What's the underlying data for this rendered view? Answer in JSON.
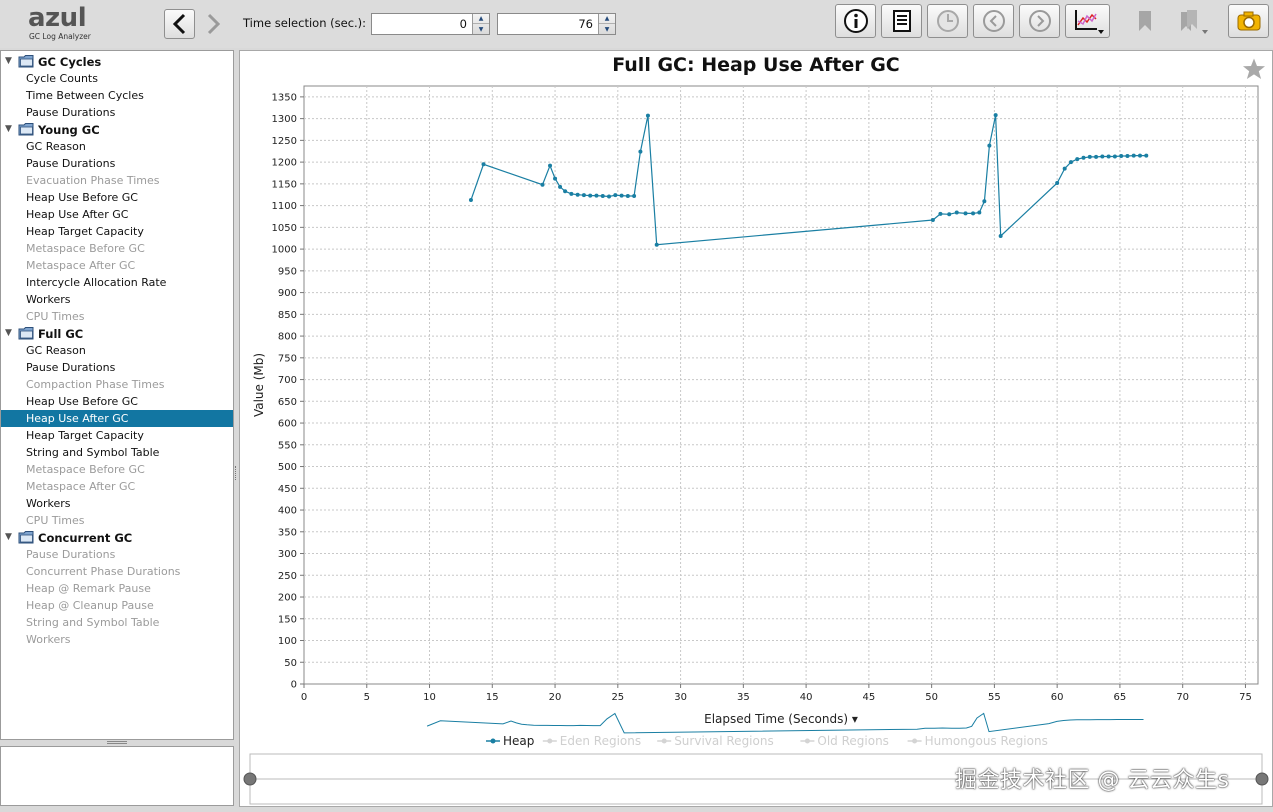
{
  "app": {
    "logo_text": "azul",
    "logo_subtitle": "GC Log Analyzer"
  },
  "toolbar": {
    "time_selection_label": "Time selection (sec.):",
    "time_from": "0",
    "time_to": "76",
    "buttons": [
      "back-icon",
      "forward-icon",
      "info-icon",
      "log-icon",
      "clock-icon",
      "previous-icon",
      "next-icon",
      "chart-type-icon",
      "bookmark-icon",
      "bookmarks-icon",
      "screenshot-icon"
    ]
  },
  "sidebar": {
    "groups": [
      {
        "label": "GC Cycles",
        "items": [
          {
            "label": "Cycle Counts",
            "enabled": true
          },
          {
            "label": "Time Between Cycles",
            "enabled": true
          },
          {
            "label": "Pause Durations",
            "enabled": true
          }
        ]
      },
      {
        "label": "Young GC",
        "items": [
          {
            "label": "GC Reason",
            "enabled": true
          },
          {
            "label": "Pause Durations",
            "enabled": true
          },
          {
            "label": "Evacuation Phase Times",
            "enabled": false
          },
          {
            "label": "Heap Use Before GC",
            "enabled": true
          },
          {
            "label": "Heap Use After GC",
            "enabled": true
          },
          {
            "label": "Heap Target Capacity",
            "enabled": true
          },
          {
            "label": "Metaspace Before GC",
            "enabled": false
          },
          {
            "label": "Metaspace After GC",
            "enabled": false
          },
          {
            "label": "Intercycle Allocation Rate",
            "enabled": true
          },
          {
            "label": "Workers",
            "enabled": true
          },
          {
            "label": "CPU Times",
            "enabled": false
          }
        ]
      },
      {
        "label": "Full GC",
        "items": [
          {
            "label": "GC Reason",
            "enabled": true
          },
          {
            "label": "Pause Durations",
            "enabled": true
          },
          {
            "label": "Compaction Phase Times",
            "enabled": false
          },
          {
            "label": "Heap Use Before GC",
            "enabled": true
          },
          {
            "label": "Heap Use After GC",
            "enabled": true,
            "selected": true
          },
          {
            "label": "Heap Target Capacity",
            "enabled": true
          },
          {
            "label": "String and Symbol Table",
            "enabled": true
          },
          {
            "label": "Metaspace Before GC",
            "enabled": false
          },
          {
            "label": "Metaspace After GC",
            "enabled": false
          },
          {
            "label": "Workers",
            "enabled": true
          },
          {
            "label": "CPU Times",
            "enabled": false
          }
        ]
      },
      {
        "label": "Concurrent GC",
        "items": [
          {
            "label": "Pause Durations",
            "enabled": false
          },
          {
            "label": "Concurrent Phase Durations",
            "enabled": false
          },
          {
            "label": "Heap @ Remark Pause",
            "enabled": false
          },
          {
            "label": "Heap @ Cleanup Pause",
            "enabled": false
          },
          {
            "label": "String and Symbol Table",
            "enabled": false
          },
          {
            "label": "Workers",
            "enabled": false
          }
        ]
      }
    ]
  },
  "chart_data": {
    "type": "line",
    "title": "Full GC: Heap Use After GC",
    "xlabel": "Elapsed Time (Seconds) ▾",
    "ylabel": "Value (Mb)",
    "xlim": [
      0,
      76
    ],
    "ylim": [
      0,
      1375
    ],
    "x_ticks": [
      0,
      5,
      10,
      15,
      20,
      25,
      30,
      35,
      40,
      45,
      50,
      55,
      60,
      65,
      70,
      75
    ],
    "y_ticks": [
      0,
      50,
      100,
      150,
      200,
      250,
      300,
      350,
      400,
      450,
      500,
      550,
      600,
      650,
      700,
      750,
      800,
      850,
      900,
      950,
      1000,
      1050,
      1100,
      1150,
      1200,
      1250,
      1300,
      1350
    ],
    "grid": true,
    "legend_position": "bottom",
    "series": [
      {
        "name": "Heap",
        "enabled": true,
        "color": "#1a7fa3",
        "x": [
          13.3,
          14.3,
          19.0,
          19.6,
          20.0,
          20.4,
          20.8,
          21.3,
          21.8,
          22.3,
          22.8,
          23.3,
          23.8,
          24.3,
          24.8,
          25.3,
          25.8,
          26.3,
          26.8,
          27.4,
          28.1,
          50.1,
          50.7,
          51.4,
          52.0,
          52.7,
          53.3,
          53.8,
          54.2,
          54.6,
          55.1,
          55.5,
          60.0,
          60.6,
          61.1,
          61.6,
          62.1,
          62.6,
          63.1,
          63.6,
          64.1,
          64.6,
          65.1,
          65.6,
          66.1,
          66.6,
          67.1
        ],
        "values": [
          1113,
          1195,
          1148,
          1192,
          1162,
          1143,
          1133,
          1127,
          1125,
          1124,
          1123,
          1123,
          1122,
          1121,
          1124,
          1123,
          1122,
          1122,
          1224,
          1307,
          1010,
          1067,
          1081,
          1080,
          1084,
          1082,
          1082,
          1084,
          1110,
          1238,
          1308,
          1030,
          1152,
          1185,
          1200,
          1207,
          1210,
          1212,
          1212,
          1213,
          1213,
          1213,
          1214,
          1214,
          1215,
          1215,
          1215
        ]
      },
      {
        "name": "Eden Regions",
        "enabled": false
      },
      {
        "name": "Survival Regions",
        "enabled": false
      },
      {
        "name": "Old Regions",
        "enabled": false
      },
      {
        "name": "Humongous Regions",
        "enabled": false
      }
    ]
  },
  "watermark": "掘金技术社区 @ 云云众生s"
}
